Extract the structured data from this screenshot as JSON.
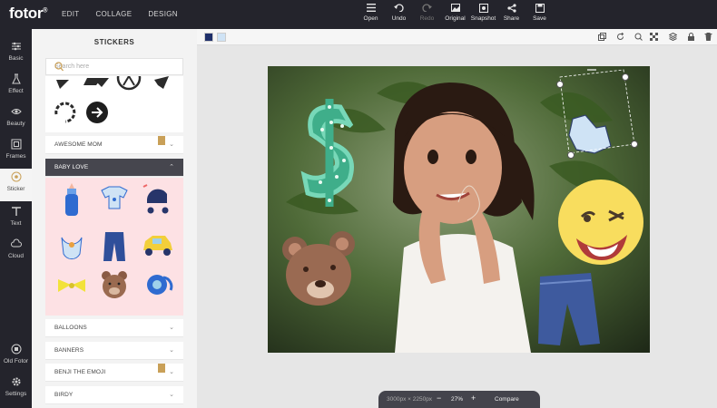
{
  "app": {
    "logo": "fotor"
  },
  "topnav": [
    "EDIT",
    "COLLAGE",
    "DESIGN"
  ],
  "toolbar": [
    {
      "label": "Open",
      "icon": "menu-icon",
      "enabled": true
    },
    {
      "label": "Undo",
      "icon": "undo-icon",
      "enabled": true
    },
    {
      "label": "Redo",
      "icon": "redo-icon",
      "enabled": false
    },
    {
      "label": "Original",
      "icon": "image-icon",
      "enabled": true
    },
    {
      "label": "Snapshot",
      "icon": "snapshot-icon",
      "enabled": true
    },
    {
      "label": "Share",
      "icon": "share-icon",
      "enabled": true
    },
    {
      "label": "Save",
      "icon": "save-icon",
      "enabled": true
    }
  ],
  "rail": [
    "Basic",
    "Effect",
    "Beauty",
    "Frames",
    "Sticker",
    "Text",
    "Cloud",
    "Old Fotor",
    "Settings"
  ],
  "rail_active": "Sticker",
  "panel": {
    "title": "STICKERS",
    "search_placeholder": "Search here",
    "categories": [
      "AWESOME MOM",
      "BABY LOVE",
      "BALLOONS",
      "BANNERS",
      "BENJI THE EMOJI",
      "BIRDY"
    ],
    "open_category": "BABY LOVE"
  },
  "canvas": {
    "swatches": [
      "#1f2f6a",
      "#cfe3f5"
    ],
    "size_text": "3000px × 2250px",
    "zoom": "27%",
    "compare_label": "Compare"
  },
  "colors": {
    "dark": "#24242c",
    "accent": "#c9a058",
    "grid_bg": "#fde1e4"
  }
}
